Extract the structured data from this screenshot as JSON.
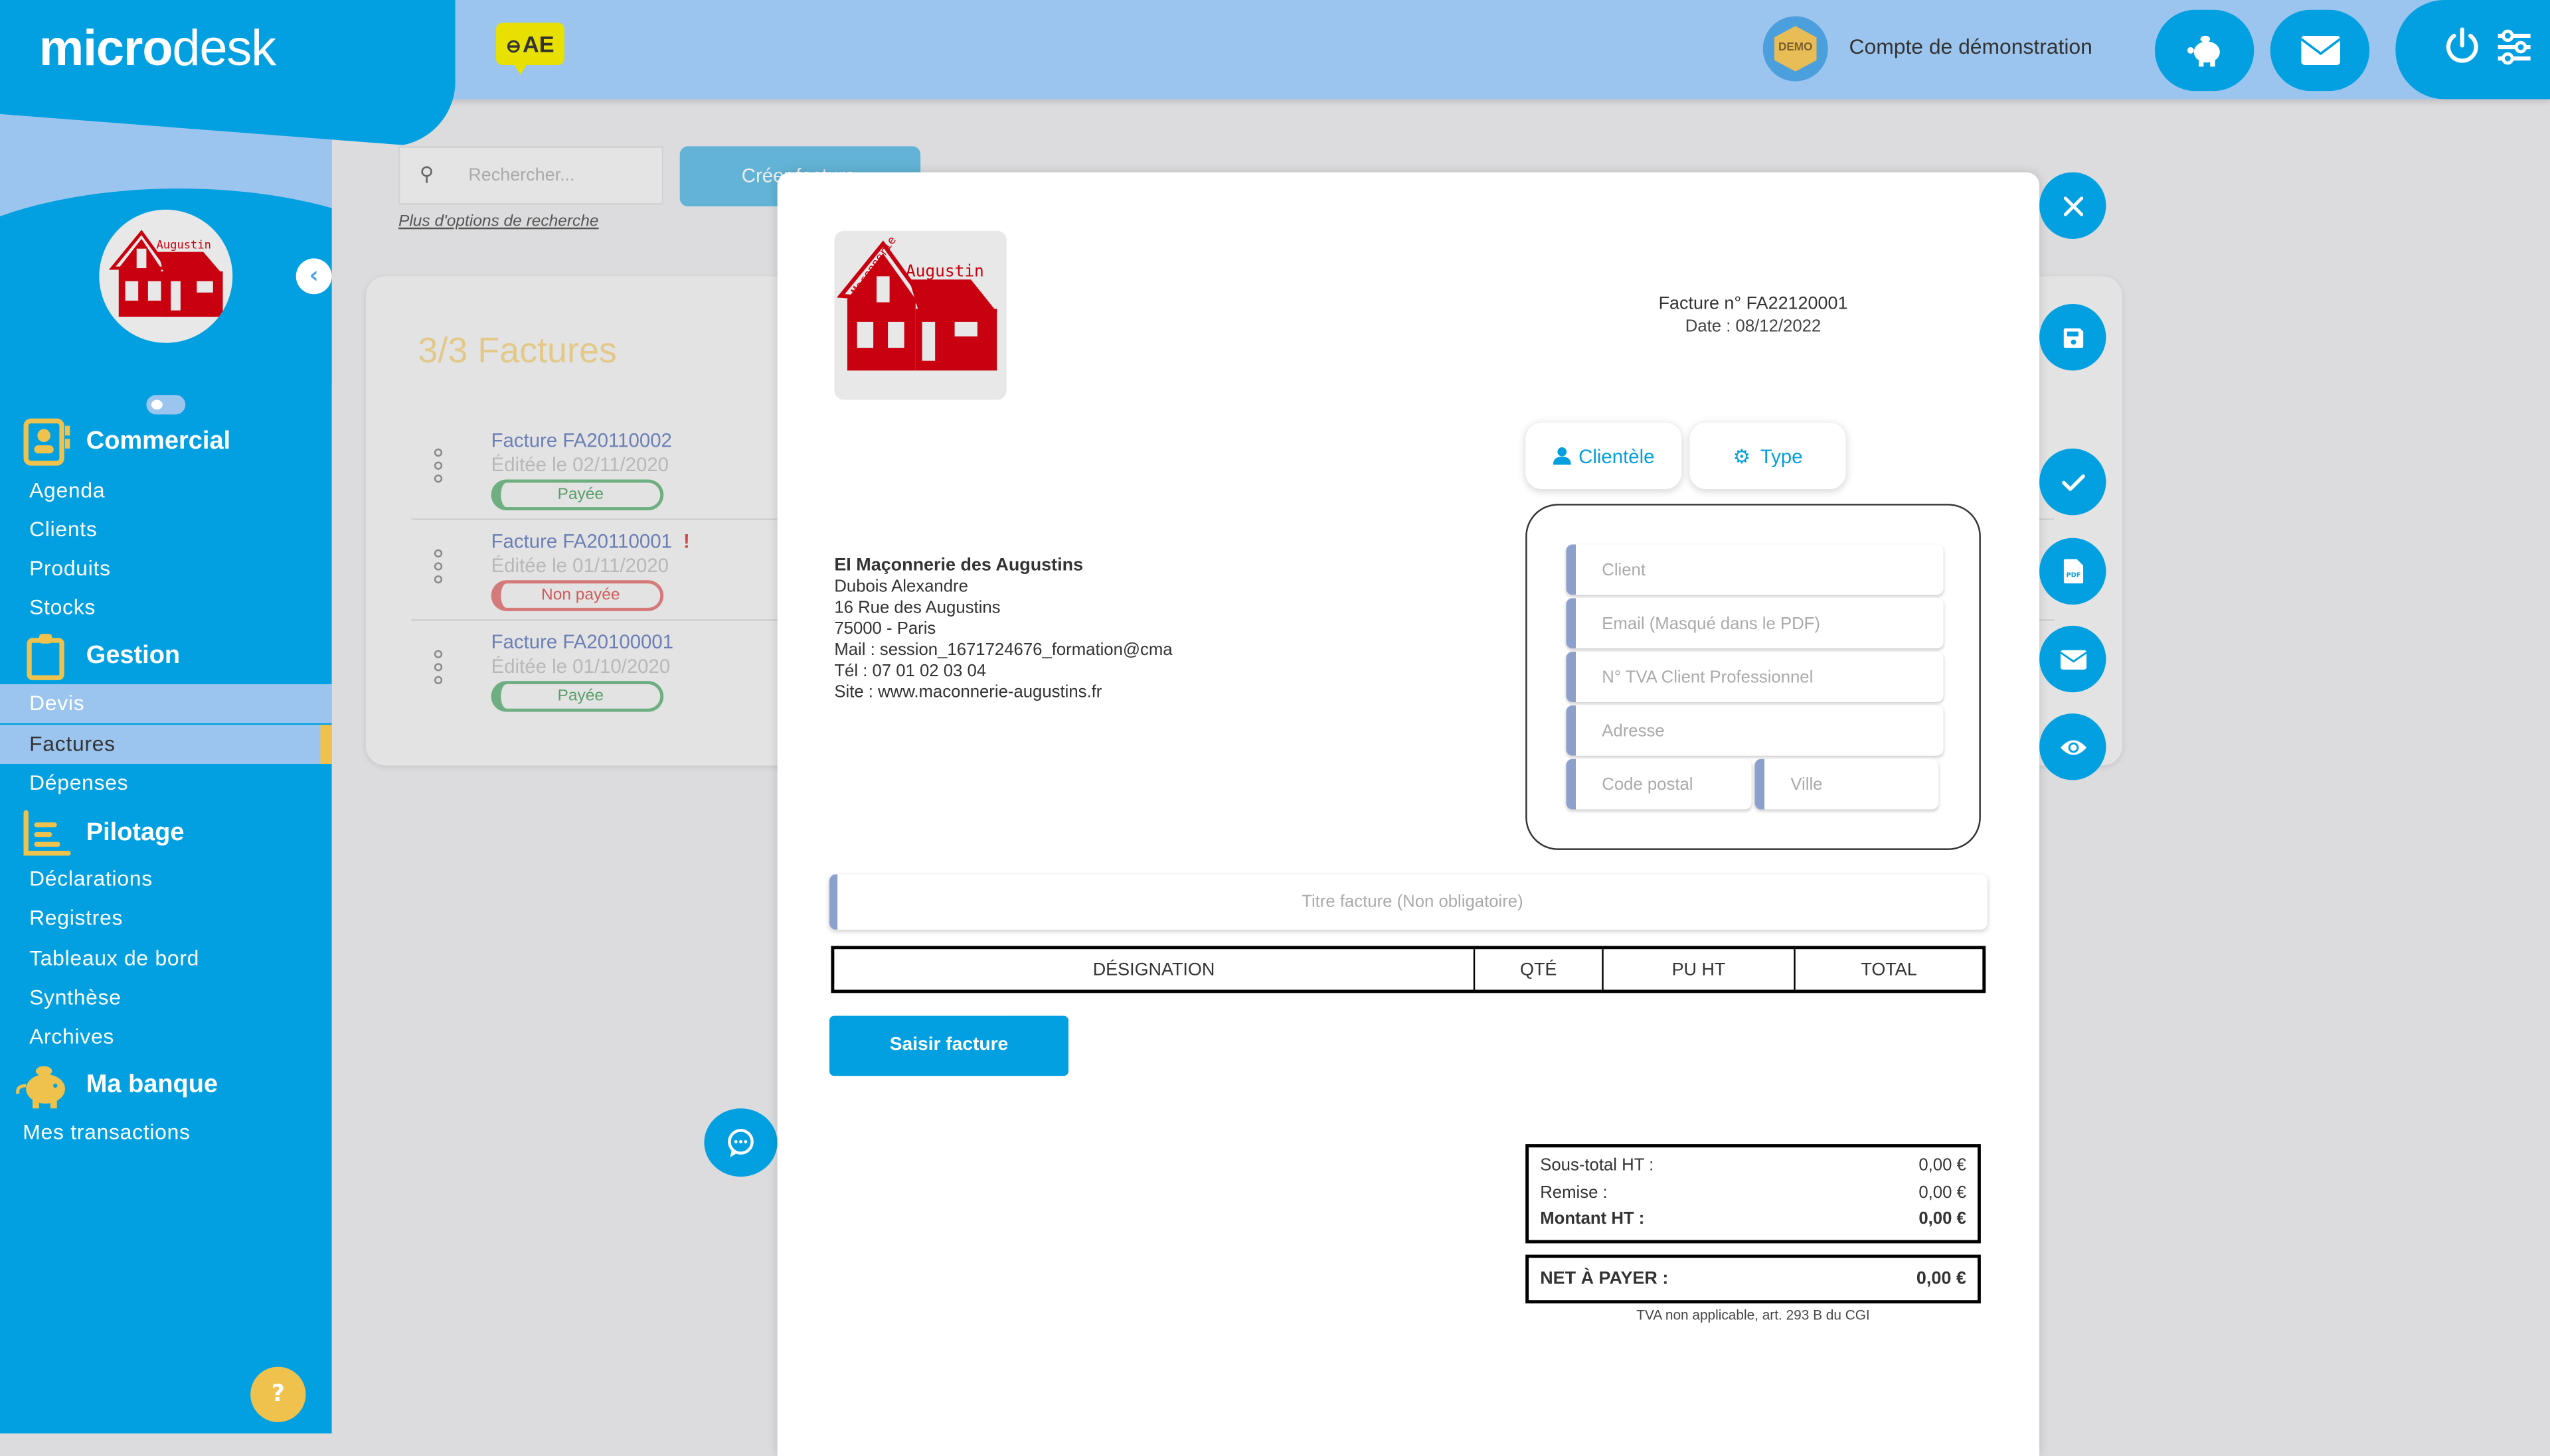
{
  "header": {
    "logo_bold": "micro",
    "logo_light": "desk",
    "badge": "AE",
    "account_avatar_text": "DEMO",
    "account_label": "Compte de démonstration",
    "icons": [
      "piggy-bank-icon",
      "envelope-icon",
      "power-icon",
      "sliders-icon"
    ]
  },
  "sidebar": {
    "sections": [
      {
        "label": "Commercial",
        "icon": "contact-book-icon",
        "items": [
          "Agenda",
          "Clients",
          "Produits",
          "Stocks"
        ]
      },
      {
        "label": "Gestion",
        "icon": "clipboard-icon",
        "items": [
          "Devis",
          "Factures",
          "Dépenses"
        ]
      },
      {
        "label": "Pilotage",
        "icon": "chart-lines-icon",
        "items": [
          "Déclarations",
          "Registres",
          "Tableaux de bord",
          "Synthèse",
          "Archives"
        ]
      },
      {
        "label": "Ma banque",
        "icon": "piggy-bank-icon",
        "items": [
          "Mes transactions"
        ]
      }
    ],
    "active_item": "Factures",
    "highlighted_item": "Devis",
    "help_icon": "help-bubble-icon"
  },
  "main": {
    "search": {
      "placeholder": "Rechercher..."
    },
    "create_button": "Créer facture",
    "more_options": "Plus d'options de recherche",
    "list_title": "3/3 Factures",
    "invoices": [
      {
        "name": "Facture FA20110002",
        "date": "Éditée le 02/11/2020",
        "status": "Payée",
        "alert": ""
      },
      {
        "name": "Facture FA20110001",
        "date": "Éditée le 01/11/2020",
        "status": "Non payée",
        "alert": "!"
      },
      {
        "name": "Facture FA20100001",
        "date": "Éditée le 01/10/2020",
        "status": "Payée",
        "alert": ""
      }
    ]
  },
  "modal": {
    "invoice_number": "Facture n° FA22120001",
    "invoice_date": "Date : 08/12/2022",
    "logo_text_top": "Augustin",
    "logo_text_side": "Maçonnerie",
    "tabs": [
      {
        "label": "Clientèle",
        "icon": "user-icon"
      },
      {
        "label": "Type",
        "icon": "gear-icon"
      }
    ],
    "client_fields": {
      "client": "Client",
      "email": "Email (Masqué dans le PDF)",
      "vat": "N° TVA Client Professionnel",
      "address": "Adresse",
      "zip": "Code postal",
      "city": "Ville"
    },
    "issuer": {
      "name": "EI Maçonnerie des Augustins",
      "contact": "Dubois Alexandre",
      "street": "16 Rue des Augustins",
      "city": "75000 - Paris",
      "mail": "Mail : session_1671724676_formation@cma",
      "phone": "Tél : 07 01 02 03 04",
      "site": "Site : www.maconnerie-augustins.fr"
    },
    "title_placeholder": "Titre facture (Non obligatoire)",
    "table_headers": [
      "DÉSIGNATION",
      "QTÉ",
      "PU HT",
      "TOTAL"
    ],
    "enter_invoice_button": "Saisir facture",
    "totals": {
      "subtotal_label": "Sous-total HT :",
      "subtotal_value": "0,00 €",
      "discount_label": "Remise :",
      "discount_value": "0,00 €",
      "amount_label": "Montant HT :",
      "amount_value": "0,00 €",
      "net_label": "NET À PAYER :",
      "net_value": "0,00 €"
    },
    "vat_note": "TVA non applicable, art. 293 B du CGI"
  },
  "actions": [
    "close-icon",
    "save-icon",
    "check-icon",
    "pdf-icon",
    "envelope-icon",
    "eye-icon"
  ],
  "colors": {
    "primary": "#02a0e1",
    "light": "#9bc5ee",
    "accent": "#efc24d",
    "paid": "#6fae80",
    "unpaid": "#d47a7a"
  }
}
